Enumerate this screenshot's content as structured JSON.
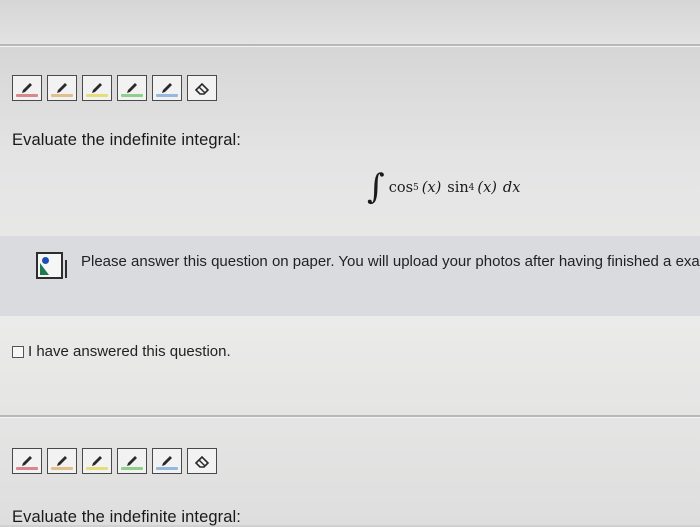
{
  "question1": {
    "tools": [
      {
        "name": "pen",
        "color": "#d9868c"
      },
      {
        "name": "pen",
        "color": "#dfbf8a"
      },
      {
        "name": "pen",
        "color": "#e4dd7a"
      },
      {
        "name": "pen",
        "color": "#8ecf8c"
      },
      {
        "name": "pen",
        "color": "#96b8dd"
      }
    ],
    "eraser_icon": "eraser-icon",
    "prompt": "Evaluate the indefinite integral:",
    "formula": {
      "integral": "∫",
      "cos": "cos",
      "cos_exp": "5",
      "cos_arg": "(x)",
      "sin": "sin",
      "sin_exp": "4",
      "sin_arg": "(x)",
      "dx": "dx"
    },
    "notice": {
      "icon": "image-upload-icon",
      "text": "Please answer this question on paper. You will upload your photos after having finished a exam."
    },
    "checkbox_label": "I have answered this question."
  },
  "question2": {
    "prompt": "Evaluate the indefinite integral:"
  }
}
